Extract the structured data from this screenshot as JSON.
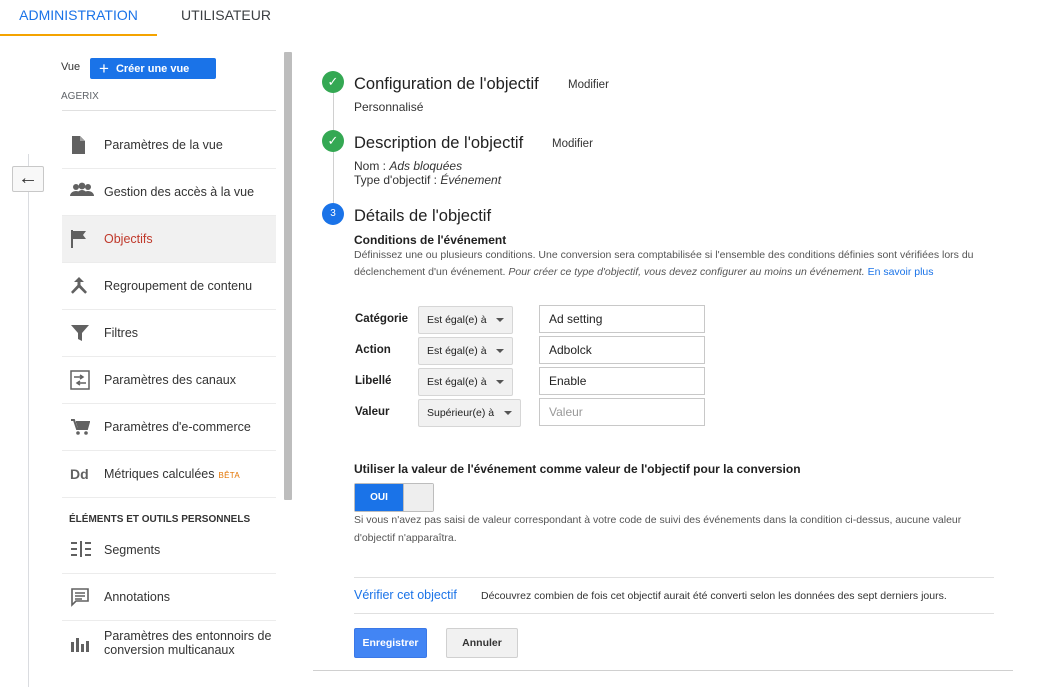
{
  "tabs": {
    "admin": "ADMINISTRATION",
    "user": "UTILISATEUR"
  },
  "accent_color": "#1a73e8",
  "sidebar": {
    "view_label": "Vue",
    "create_view": "Créer une vue",
    "account": "AGERIX",
    "section_title": "ÉLÉMENTS ET OUTILS PERSONNELS",
    "beta": "BÊTA",
    "items": [
      {
        "label": "Paramètres de la vue",
        "icon": "document-icon"
      },
      {
        "label": "Gestion des accès à la vue",
        "icon": "people-icon"
      },
      {
        "label": "Objectifs",
        "icon": "flag-icon",
        "active": true
      },
      {
        "label": "Regroupement de contenu",
        "icon": "merge-icon"
      },
      {
        "label": "Filtres",
        "icon": "filter-icon"
      },
      {
        "label": "Paramètres des canaux",
        "icon": "channel-icon"
      },
      {
        "label": "Paramètres d'e-commerce",
        "icon": "cart-icon"
      },
      {
        "label": "Métriques calculées",
        "icon": "dd-icon"
      },
      {
        "label": "Segments",
        "icon": "segments-icon"
      },
      {
        "label": "Annotations",
        "icon": "comment-icon"
      },
      {
        "label": "Paramètres des entonnoirs de conversion multicanaux",
        "icon": "bar-chart-icon"
      }
    ]
  },
  "steps": {
    "config_title": "Configuration de l'objectif",
    "config_modify": "Modifier",
    "config_sub": "Personnalisé",
    "desc_title": "Description de l'objectif",
    "desc_modify": "Modifier",
    "name_label": "Nom : ",
    "name_value": "Ads bloquées",
    "type_label": "Type d'objectif : ",
    "type_value": "Événement",
    "details_number": "3",
    "details_title": "Détails de l'objectif"
  },
  "conditions": {
    "title": "Conditions de l'événement",
    "desc_plain": "Définissez une ou plusieurs conditions. Une conversion sera comptabilisée si l'ensemble des conditions définies sont vérifiées lors du déclenchement d'un événement. ",
    "desc_italic": "Pour créer ce type d'objectif, vous devez configurer au moins un événement.",
    "learn_more": "En savoir plus",
    "rows": [
      {
        "label": "Catégorie",
        "operator": "Est égal(e) à",
        "value": "Ad setting",
        "placeholder": ""
      },
      {
        "label": "Action",
        "operator": "Est égal(e) à",
        "value": "Adbolck",
        "placeholder": ""
      },
      {
        "label": "Libellé",
        "operator": "Est égal(e) à",
        "value": "Enable",
        "placeholder": ""
      },
      {
        "label": "Valeur",
        "operator": "Supérieur(e) à",
        "value": "",
        "placeholder": "Valeur"
      }
    ]
  },
  "use_value": {
    "title": "Utiliser la valeur de l'événement comme valeur de l'objectif pour la conversion",
    "toggle_on": "OUI",
    "note": "Si vous n'avez pas saisi de valeur correspondant à votre code de suivi des événements dans la condition ci-dessus, aucune valeur d'objectif n'apparaîtra."
  },
  "verify": {
    "link": "Vérifier cet objectif",
    "desc": "Découvrez combien de fois cet objectif aurait été converti selon les données des sept derniers jours."
  },
  "actions": {
    "save": "Enregistrer",
    "cancel": "Annuler"
  }
}
